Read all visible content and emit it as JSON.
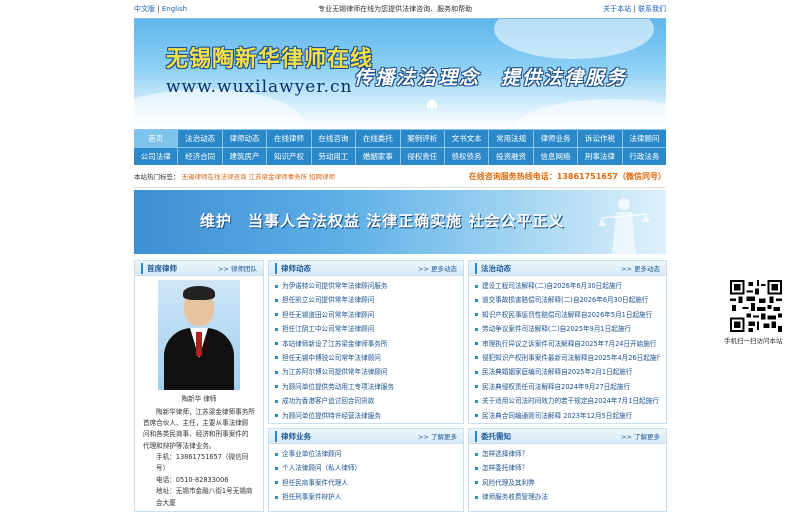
{
  "topbar": {
    "lang_cn": "中文版",
    "sep": "|",
    "lang_en": "English",
    "tagline": "专业无锡律师在线为您提供法律咨询、服务和帮助",
    "about": "关于本站",
    "contact": "联系我们"
  },
  "banner": {
    "brand": "无锡陶新华律师在线",
    "url": "www.wuxilawyer.cn",
    "slogan": "传播法治理念　提供法律服务"
  },
  "nav": {
    "row1": [
      "首页",
      "法治动态",
      "律师动态",
      "在线律师",
      "在线咨询",
      "在线委托",
      "案例评析",
      "文书文本",
      "常用法规",
      "律师业务",
      "诉讼作税",
      "法律顾问"
    ],
    "row2": [
      "公司法律",
      "经济合同",
      "建筑房产",
      "知识产权",
      "劳动用工",
      "婚姻家事",
      "侵权责任",
      "债权债务",
      "投资融资",
      "信息网络",
      "刑事法律",
      "行政法务"
    ]
  },
  "hot": {
    "label": "本站热门标签：",
    "tags": "无锡律师在线法律咨询 江苏梁金律师事务所 招聘律师",
    "phone": "在线咨询服务热线电话：13861751657（微信同号）"
  },
  "banner2": {
    "text": "维护　当事人合法权益 法律正确实施 社会公平正义"
  },
  "lead_lawyer": {
    "title": "首席律师",
    "more": ">> 律师团队",
    "name": "陶新华 律师",
    "desc": "陶新华律师，江苏梁金律师事务所首席合伙人、主任，主要从事法律顾问和各类民商事、经济和刑事案件的代理和辩护等法律业务。",
    "phone": "手机：13861751657（微信同号）",
    "tel": "电话：0510-82833006",
    "addr": "地址：无锡市金融八街1号无锡商会大厦"
  },
  "lawyer_news": {
    "title": "律师动态",
    "more": ">> 更多动态",
    "items": [
      "为伊诺特公司提供常年法律顾问服务",
      "担任凯立公司提供常年法律顾问",
      "担任无锡道田公司常年法律顾问",
      "担任江阴工中公司常年法律顾问",
      "本站律师新设了江苏梁金律师事务所",
      "担任无锡中博锐公司常年法律顾问",
      "为江苏阿尔博公司提供常年法律顾问",
      "为顾问单位提供劳动用工专项法律服务",
      "成功为香港客户追讨回合同货款",
      "为顾问单位提供特许经营法律服务"
    ]
  },
  "legal_news": {
    "title": "法治动态",
    "more": ">> 更多动态",
    "items": [
      "建设工程司法解释(二)自2026年6月30日起施行",
      "道交事故损害赔偿司法解释(二)自2026年6月30日起施行",
      "知识产权民事惩罚性赔偿司法解释自2026年5月1日起施行",
      "劳动争议案件司法解释(二)自2025年9月1日起施行",
      "审理执行异议之诉案件司法解释自2025年7月24日开始施行",
      "侵犯知识产权刑事案件最新司法解释自2025年4月26日起施行",
      "民法典婚姻家庭编司法解释自2025年2月1日起施行",
      "民法典侵权责任司法解释自2024年9月27日起施行",
      "关于适用公司法时间效力的若干规定自2024年7月1日起施行",
      "民法典合同编通则司法解释 2023年12月5日起施行"
    ]
  },
  "lawyer_business": {
    "title": "律师业务",
    "more": ">> 了解更多",
    "items": [
      "企事业单位法律顾问",
      "个人法律顾问（私人律师）",
      "担任民商事案件代理人",
      "担任刑事案件辩护人"
    ]
  },
  "entrust": {
    "title": "委托需知",
    "more": ">> 了解更多",
    "items": [
      "怎样选择律师？",
      "怎样委托律师？",
      "风险代理及其利弊",
      "律师服务收费管理办法"
    ]
  },
  "qr": {
    "caption": "手机扫一扫访问本站"
  },
  "colors": {
    "nav_bg": "#2b88c9",
    "nav_active": "#7ec3ec",
    "link": "#1a4f8e",
    "hot_tags": "#d8681a",
    "phone": "#e06a0c"
  }
}
